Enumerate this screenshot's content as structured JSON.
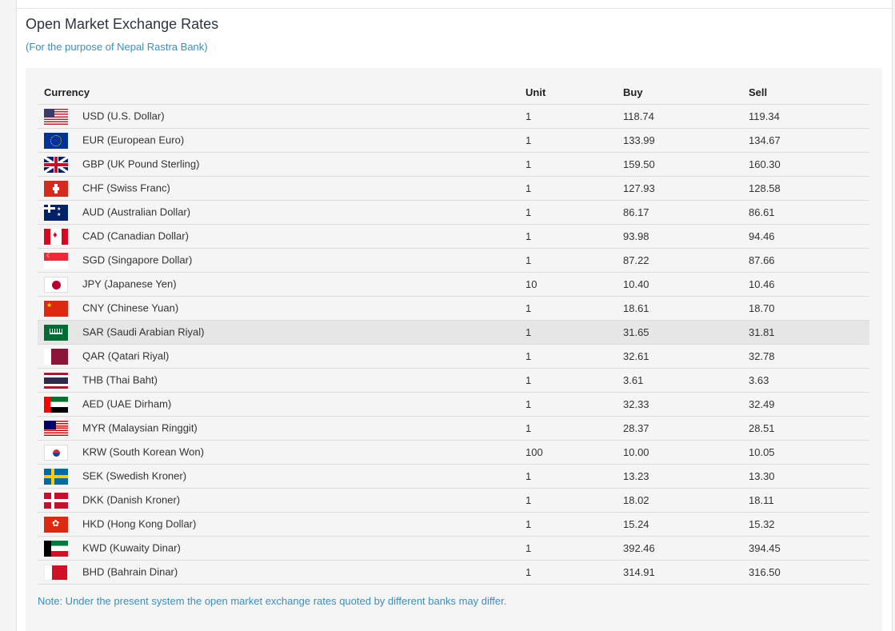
{
  "page": {
    "title": "Open Market Exchange Rates",
    "subtitle": "(For the purpose of Nepal Rastra Bank)",
    "note": "Note: Under the present system the open market exchange rates quoted by different banks may differ."
  },
  "table": {
    "headers": {
      "currency": "Currency",
      "unit": "Unit",
      "buy": "Buy",
      "sell": "Sell"
    },
    "rows": [
      {
        "code": "usd",
        "currency": "USD (U.S. Dollar)",
        "unit": "1",
        "buy": "118.74",
        "sell": "119.34"
      },
      {
        "code": "eur",
        "currency": "EUR (European Euro)",
        "unit": "1",
        "buy": "133.99",
        "sell": "134.67"
      },
      {
        "code": "gbp",
        "currency": "GBP (UK Pound Sterling)",
        "unit": "1",
        "buy": "159.50",
        "sell": "160.30"
      },
      {
        "code": "chf",
        "currency": "CHF (Swiss Franc)",
        "unit": "1",
        "buy": "127.93",
        "sell": "128.58"
      },
      {
        "code": "aud",
        "currency": "AUD (Australian Dollar)",
        "unit": "1",
        "buy": "86.17",
        "sell": "86.61"
      },
      {
        "code": "cad",
        "currency": "CAD (Canadian Dollar)",
        "unit": "1",
        "buy": "93.98",
        "sell": "94.46"
      },
      {
        "code": "sgd",
        "currency": "SGD (Singapore Dollar)",
        "unit": "1",
        "buy": "87.22",
        "sell": "87.66"
      },
      {
        "code": "jpy",
        "currency": "JPY (Japanese Yen)",
        "unit": "10",
        "buy": "10.40",
        "sell": "10.46"
      },
      {
        "code": "cny",
        "currency": "CNY (Chinese Yuan)",
        "unit": "1",
        "buy": "18.61",
        "sell": "18.70"
      },
      {
        "code": "sar",
        "currency": "SAR (Saudi Arabian Riyal)",
        "unit": "1",
        "buy": "31.65",
        "sell": "31.81",
        "highlighted": true
      },
      {
        "code": "qar",
        "currency": "QAR (Qatari Riyal)",
        "unit": "1",
        "buy": "32.61",
        "sell": "32.78"
      },
      {
        "code": "thb",
        "currency": "THB (Thai Baht)",
        "unit": "1",
        "buy": "3.61",
        "sell": "3.63"
      },
      {
        "code": "aed",
        "currency": "AED (UAE Dirham)",
        "unit": "1",
        "buy": "32.33",
        "sell": "32.49"
      },
      {
        "code": "myr",
        "currency": "MYR (Malaysian Ringgit)",
        "unit": "1",
        "buy": "28.37",
        "sell": "28.51"
      },
      {
        "code": "krw",
        "currency": "KRW (South Korean Won)",
        "unit": "100",
        "buy": "10.00",
        "sell": "10.05"
      },
      {
        "code": "sek",
        "currency": "SEK (Swedish Kroner)",
        "unit": "1",
        "buy": "13.23",
        "sell": "13.30"
      },
      {
        "code": "dkk",
        "currency": "DKK (Danish Kroner)",
        "unit": "1",
        "buy": "18.02",
        "sell": "18.11"
      },
      {
        "code": "hkd",
        "currency": "HKD (Hong Kong Dollar)",
        "unit": "1",
        "buy": "15.24",
        "sell": "15.32"
      },
      {
        "code": "kwd",
        "currency": "KWD (Kuwaity Dinar)",
        "unit": "1",
        "buy": "392.46",
        "sell": "394.45"
      },
      {
        "code": "bhd",
        "currency": "BHD (Bahrain Dinar)",
        "unit": "1",
        "buy": "314.91",
        "sell": "316.50"
      }
    ]
  },
  "colors": {
    "accent": "#3a8fc0",
    "panel": "#f5f5f5",
    "highlight_row": "#e6e6e6"
  }
}
